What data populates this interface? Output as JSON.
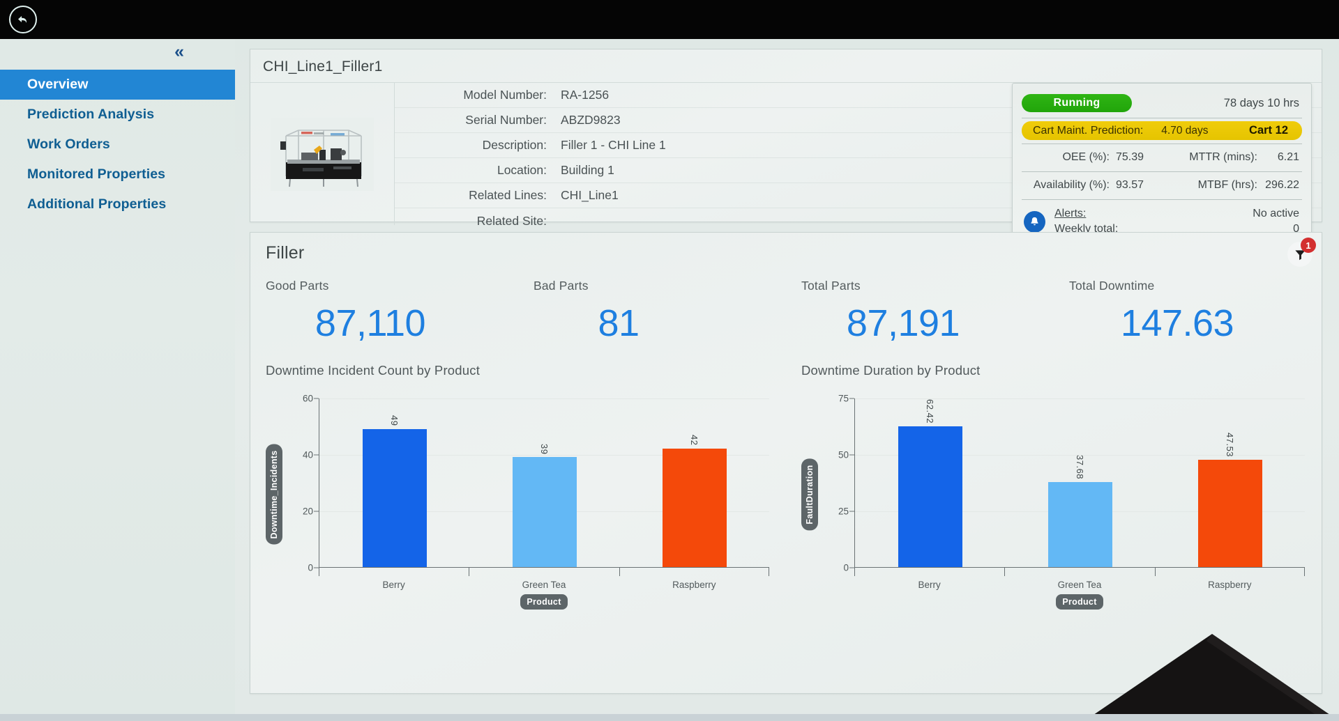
{
  "topbar": {
    "back_icon": "back-arrow-icon"
  },
  "sidebar": {
    "collapse_icon": "chevron-double-left-icon",
    "items": [
      {
        "label": "Overview",
        "active": true
      },
      {
        "label": "Prediction Analysis",
        "active": false
      },
      {
        "label": "Work Orders",
        "active": false
      },
      {
        "label": "Monitored Properties",
        "active": false
      },
      {
        "label": "Additional Properties",
        "active": false
      }
    ]
  },
  "asset": {
    "title": "CHI_Line1_Filler1",
    "image_alt": "filler-machine-photo",
    "specs": [
      {
        "label": "Model Number:",
        "value": "RA-1256"
      },
      {
        "label": "Serial Number:",
        "value": "ABZD9823"
      },
      {
        "label": "Description:",
        "value": "Filler 1 - CHI Line 1"
      },
      {
        "label": "Location:",
        "value": "Building 1"
      },
      {
        "label": "Related Lines:",
        "value": "CHI_Line1"
      },
      {
        "label": "Related Site:",
        "value": ""
      }
    ]
  },
  "status": {
    "state": "Running",
    "uptime": "78 days 10 hrs",
    "maint_label": "Cart Maint. Prediction:",
    "maint_value": "4.70 days",
    "maint_cart": "Cart 12",
    "oee_label": "OEE (%):",
    "oee_value": "75.39",
    "mttr_label": "MTTR (mins):",
    "mttr_value": "6.21",
    "availability_label": "Availability (%):",
    "availability_value": "93.57",
    "mtbf_label": "MTBF (hrs):",
    "mtbf_value": "296.22",
    "alerts_link": "Alerts:",
    "alerts_weekly_label": "Weekly total:",
    "alerts_active": "No active",
    "alerts_weekly_value": "0",
    "bell_icon": "bell-icon",
    "running_color": "#27ad0d",
    "maint_color": "#e8c500",
    "accent_blue": "#1e7fe0"
  },
  "filler": {
    "title": "Filler",
    "filter_icon": "filter-funnel-icon",
    "filter_badge": "1",
    "kpis": [
      {
        "label": "Good Parts",
        "value": "87,110"
      },
      {
        "label": "Bad Parts",
        "value": "81"
      },
      {
        "label": "Total Parts",
        "value": "87,191"
      },
      {
        "label": "Total Downtime",
        "value": "147.63"
      }
    ]
  },
  "chart_data": [
    {
      "type": "bar",
      "title": "Downtime Incident Count by Product",
      "categories": [
        "Berry",
        "Green Tea",
        "Raspberry"
      ],
      "values": [
        49,
        39,
        42
      ],
      "value_labels": [
        "49",
        "39",
        "42"
      ],
      "colors": [
        "#1464e8",
        "#63b8f5",
        "#f4490a"
      ],
      "xlabel": "Product",
      "ylabel": "Downtime_Incidents",
      "ylim": [
        0,
        60
      ],
      "yticks": [
        0,
        20,
        40,
        60
      ],
      "ytick_labels": [
        "0",
        "20",
        "40",
        "60"
      ],
      "grid": true,
      "legend": "none"
    },
    {
      "type": "bar",
      "title": "Downtime Duration by Product",
      "categories": [
        "Berry",
        "Green Tea",
        "Raspberry"
      ],
      "values": [
        62.42,
        37.68,
        47.53
      ],
      "value_labels": [
        "62.42",
        "37.68",
        "47.53"
      ],
      "colors": [
        "#1464e8",
        "#63b8f5",
        "#f4490a"
      ],
      "xlabel": "Product",
      "ylabel": "FaultDuration",
      "ylim": [
        0,
        75
      ],
      "yticks": [
        0,
        25,
        50,
        75
      ],
      "ytick_labels": [
        "0",
        "25",
        "50",
        "75"
      ],
      "grid": true,
      "legend": "none"
    }
  ]
}
